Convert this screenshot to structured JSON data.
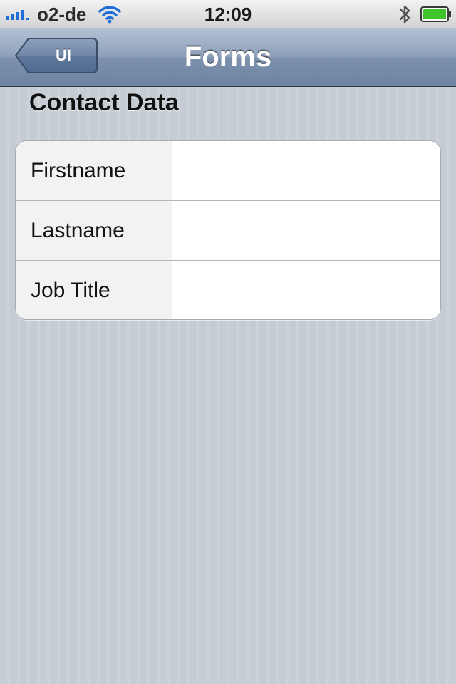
{
  "status_bar": {
    "carrier": "o2-de",
    "time": "12:09",
    "icons": [
      "signal-icon",
      "wifi-icon",
      "bluetooth-icon",
      "battery-icon"
    ]
  },
  "nav_bar": {
    "back_label": "UI",
    "title": "Forms"
  },
  "section": {
    "title": "Contact Data",
    "rows": [
      {
        "label": "Firstname",
        "value": ""
      },
      {
        "label": "Lastname",
        "value": ""
      },
      {
        "label": "Job Title",
        "value": ""
      }
    ]
  },
  "colors": {
    "nav_tint": "#6d84a2",
    "background": "#c5ccd4",
    "battery_green": "#3ec42a"
  }
}
